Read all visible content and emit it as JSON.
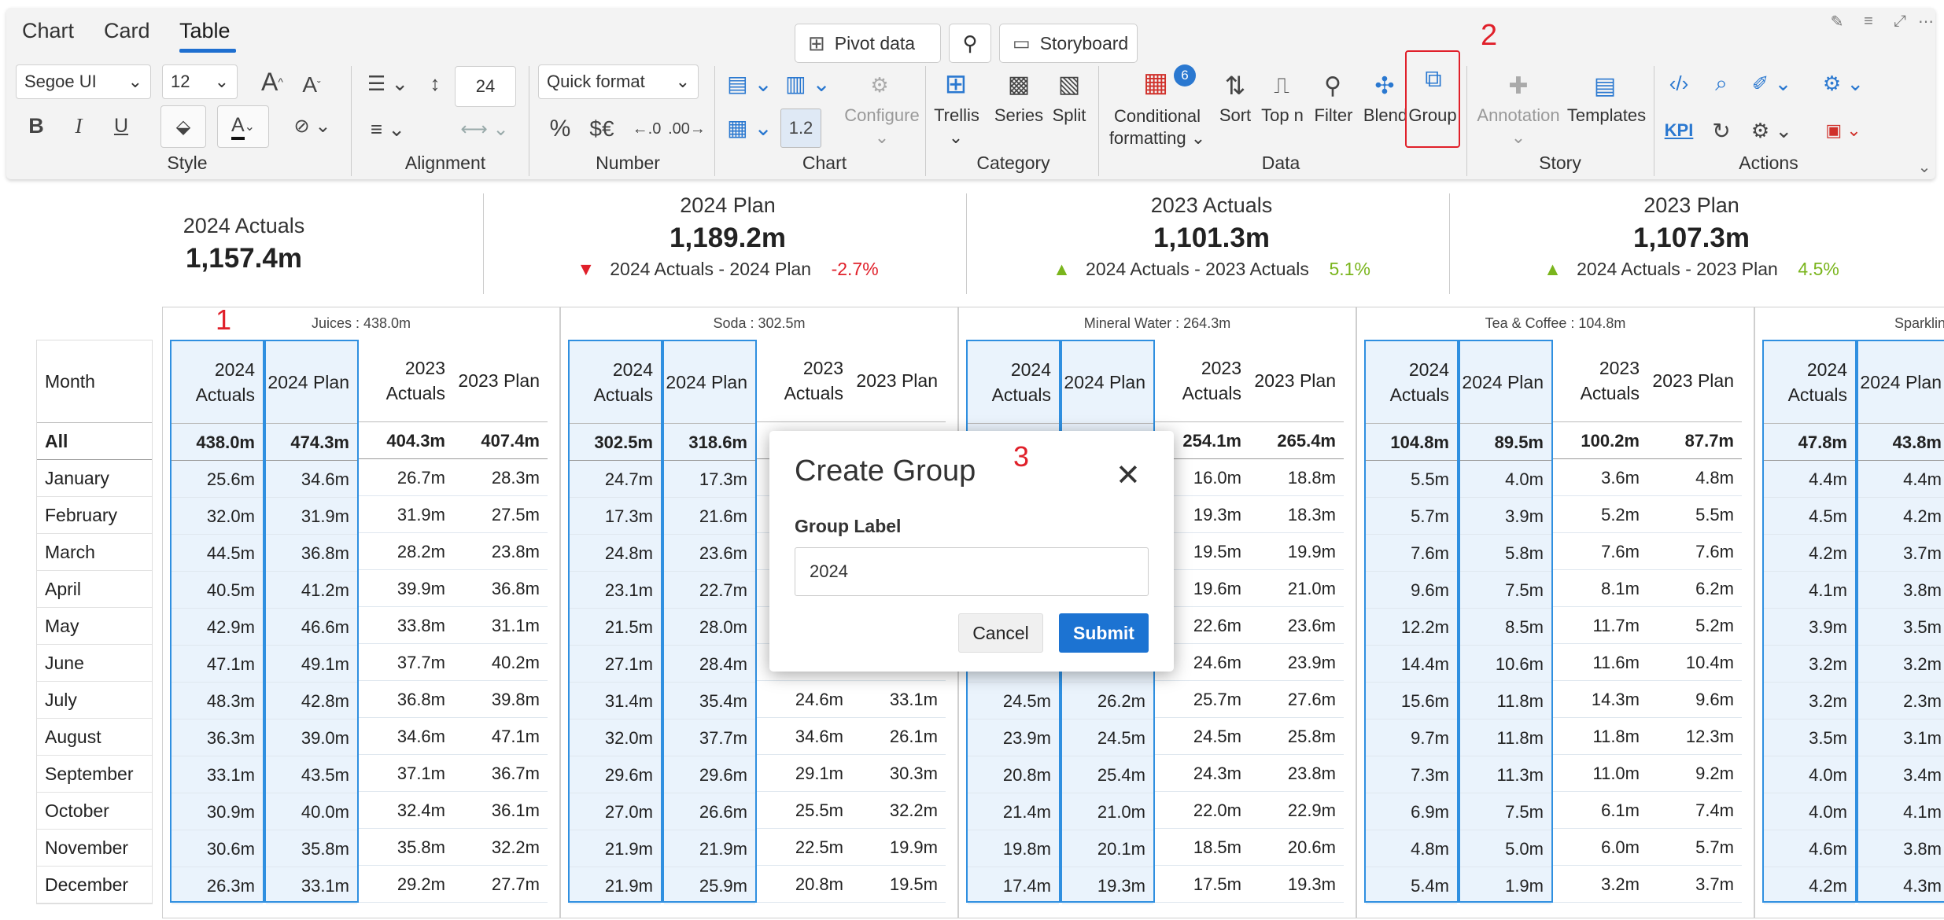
{
  "tabs": [
    "Chart",
    "Card",
    "Table"
  ],
  "topbar": {
    "pivot": "Pivot data",
    "storyboard": "Storyboard"
  },
  "style": {
    "font": "Segoe UI",
    "size": "12",
    "bold": "B",
    "italic": "I",
    "underline": "U",
    "group_label": "Style"
  },
  "alignment": {
    "spacing_value": "24",
    "group_label": "Alignment"
  },
  "number": {
    "quick_format": "Quick format",
    "percent": "%",
    "currency": "$€",
    "dec_inc": ".0",
    "dec_dec": ".00",
    "group_label": "Number"
  },
  "chart": {
    "scale": "1.2",
    "configure": "Configure",
    "group_label": "Chart"
  },
  "category": {
    "trellis": "Trellis",
    "series": "Series",
    "split": "Split",
    "group_label": "Category"
  },
  "data": {
    "conditional_formatting": "Conditional formatting",
    "cf_badge": "6",
    "sort": "Sort",
    "topn": "Top n",
    "filter": "Filter",
    "blend": "Blend",
    "group": "Group",
    "group_label": "Data"
  },
  "story": {
    "annotation": "Annotation",
    "templates": "Templates",
    "group_label": "Story"
  },
  "actions": {
    "kpi": "KPI",
    "group_label": "Actions"
  },
  "markers": {
    "m1": "1",
    "m2": "2",
    "m3": "3"
  },
  "cards": [
    {
      "title": "2024 Actuals",
      "value": "1,157.4m"
    },
    {
      "title": "2024 Plan",
      "value": "1,189.2m",
      "delta_label": "2024 Actuals - 2024 Plan",
      "delta": "-2.7%",
      "delta_color": "#e0202a",
      "arrow": "down"
    },
    {
      "title": "2023 Actuals",
      "value": "1,101.3m",
      "delta_label": "2024 Actuals - 2023 Actuals",
      "delta": "5.1%",
      "delta_color": "#7ab51d",
      "arrow": "up"
    },
    {
      "title": "2023 Plan",
      "value": "1,107.3m",
      "delta_label": "2024 Actuals - 2023 Plan",
      "delta": "4.5%",
      "delta_color": "#7ab51d",
      "arrow": "up"
    }
  ],
  "table": {
    "month_header": "Month",
    "months": [
      "All",
      "January",
      "February",
      "March",
      "April",
      "May",
      "June",
      "July",
      "August",
      "September",
      "October",
      "November",
      "December"
    ],
    "col_headers": [
      "2024 Actuals",
      "2024 Plan",
      "2023 Actuals",
      "2023 Plan"
    ],
    "groups": [
      {
        "title": "Juices :  438.0m",
        "cols": [
          [
            "438.0m",
            "25.6m",
            "32.0m",
            "44.5m",
            "40.5m",
            "42.9m",
            "47.1m",
            "48.3m",
            "36.3m",
            "33.1m",
            "30.9m",
            "30.6m",
            "26.3m"
          ],
          [
            "474.3m",
            "34.6m",
            "31.9m",
            "36.8m",
            "41.2m",
            "46.6m",
            "49.1m",
            "42.8m",
            "39.0m",
            "43.5m",
            "40.0m",
            "35.8m",
            "33.1m"
          ],
          [
            "404.3m",
            "26.7m",
            "31.9m",
            "28.2m",
            "39.9m",
            "33.8m",
            "37.7m",
            "36.8m",
            "34.6m",
            "37.1m",
            "32.4m",
            "35.8m",
            "29.2m"
          ],
          [
            "407.4m",
            "28.3m",
            "27.5m",
            "23.8m",
            "36.8m",
            "31.1m",
            "40.2m",
            "39.8m",
            "47.1m",
            "36.7m",
            "36.1m",
            "32.2m",
            "27.7m"
          ]
        ]
      },
      {
        "title": "Soda :  302.5m",
        "cols": [
          [
            "302.5m",
            "24.7m",
            "17.3m",
            "24.8m",
            "23.1m",
            "21.5m",
            "27.1m",
            "31.4m",
            "32.0m",
            "29.6m",
            "27.0m",
            "21.9m",
            "21.9m"
          ],
          [
            "318.6m",
            "17.3m",
            "21.6m",
            "23.6m",
            "22.7m",
            "28.0m",
            "28.4m",
            "35.4m",
            "37.7m",
            "29.6m",
            "26.6m",
            "21.9m",
            "25.9m"
          ],
          [
            "",
            "",
            "",
            "",
            "",
            "",
            "",
            "24.6m",
            "34.6m",
            "29.1m",
            "25.5m",
            "22.5m",
            "20.8m"
          ],
          [
            "",
            "",
            "",
            "",
            "",
            "",
            "",
            "33.1m",
            "26.1m",
            "30.3m",
            "32.2m",
            "19.9m",
            "19.5m"
          ]
        ]
      },
      {
        "title": "Mineral Water :  264.3m",
        "cols": [
          [
            "",
            "",
            "",
            "",
            "",
            "",
            "",
            "24.5m",
            "23.9m",
            "20.8m",
            "21.4m",
            "19.8m",
            "17.4m"
          ],
          [
            "",
            "",
            "",
            "",
            "",
            "",
            "",
            "26.2m",
            "24.5m",
            "25.4m",
            "21.0m",
            "20.1m",
            "19.3m"
          ],
          [
            "254.1m",
            "16.0m",
            "19.3m",
            "19.5m",
            "19.6m",
            "22.6m",
            "24.6m",
            "25.7m",
            "24.5m",
            "24.3m",
            "22.0m",
            "18.5m",
            "17.5m"
          ],
          [
            "265.4m",
            "18.8m",
            "18.3m",
            "19.9m",
            "21.0m",
            "23.6m",
            "23.9m",
            "27.6m",
            "25.8m",
            "23.8m",
            "22.9m",
            "20.6m",
            "19.3m"
          ]
        ]
      },
      {
        "title": "Tea & Coffee :  104.8m",
        "cols": [
          [
            "104.8m",
            "5.5m",
            "5.7m",
            "7.6m",
            "9.6m",
            "12.2m",
            "14.4m",
            "15.6m",
            "9.7m",
            "7.3m",
            "6.9m",
            "4.8m",
            "5.4m"
          ],
          [
            "89.5m",
            "4.0m",
            "3.9m",
            "5.8m",
            "7.5m",
            "8.5m",
            "10.6m",
            "11.8m",
            "11.8m",
            "11.3m",
            "7.5m",
            "5.0m",
            "1.9m"
          ],
          [
            "100.2m",
            "3.6m",
            "5.2m",
            "7.6m",
            "8.1m",
            "11.7m",
            "11.6m",
            "14.3m",
            "11.8m",
            "11.0m",
            "6.1m",
            "6.0m",
            "3.2m"
          ],
          [
            "87.7m",
            "4.8m",
            "5.5m",
            "7.6m",
            "6.2m",
            "5.2m",
            "10.4m",
            "9.6m",
            "12.3m",
            "9.2m",
            "7.4m",
            "5.7m",
            "3.7m"
          ]
        ]
      },
      {
        "title": "Sparkling",
        "cols": [
          [
            "47.8m",
            "4.4m",
            "4.5m",
            "4.2m",
            "4.1m",
            "3.9m",
            "3.2m",
            "3.2m",
            "3.5m",
            "4.0m",
            "4.0m",
            "4.6m",
            "4.2m"
          ],
          [
            "43.8m",
            "4.4m",
            "4.2m",
            "3.7m",
            "3.8m",
            "3.5m",
            "3.2m",
            "2.3m",
            "3.1m",
            "3.4m",
            "4.1m",
            "3.8m",
            "4.3m"
          ]
        ]
      }
    ]
  },
  "dialog": {
    "title": "Create Group",
    "label": "Group Label",
    "value": "2024",
    "cancel": "Cancel",
    "submit": "Submit"
  }
}
